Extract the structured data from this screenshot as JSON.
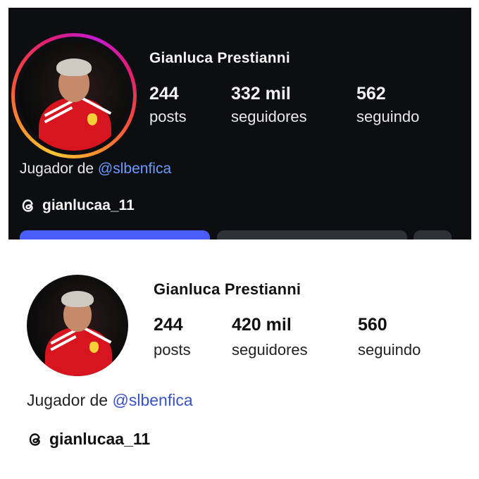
{
  "top_profile": {
    "name": "Gianluca Prestianni",
    "stats": [
      {
        "value": "244",
        "label": "posts"
      },
      {
        "value": "332 mil",
        "label": "seguidores"
      },
      {
        "value": "562",
        "label": "seguindo"
      }
    ],
    "bio_prefix": "Jugador de ",
    "bio_mention": "@slbenfica",
    "threads_handle": "gianlucaa_11",
    "story_ring": true,
    "theme": "dark",
    "colors": {
      "background": "#0d0e12",
      "mention": "#6f9bff",
      "follow_button": "#4a5df9"
    }
  },
  "bottom_profile": {
    "name": "Gianluca Prestianni",
    "stats": [
      {
        "value": "244",
        "label": "posts"
      },
      {
        "value": "420 mil",
        "label": "seguidores"
      },
      {
        "value": "560",
        "label": "seguindo"
      }
    ],
    "bio_prefix": "Jugador de ",
    "bio_mention": "@slbenfica",
    "threads_handle": "gianlucaa_11",
    "story_ring": false,
    "theme": "light",
    "colors": {
      "background": "#ffffff",
      "mention": "#3852c8"
    }
  },
  "icons": {
    "threads": "threads-icon",
    "avatar": "profile-photo"
  }
}
